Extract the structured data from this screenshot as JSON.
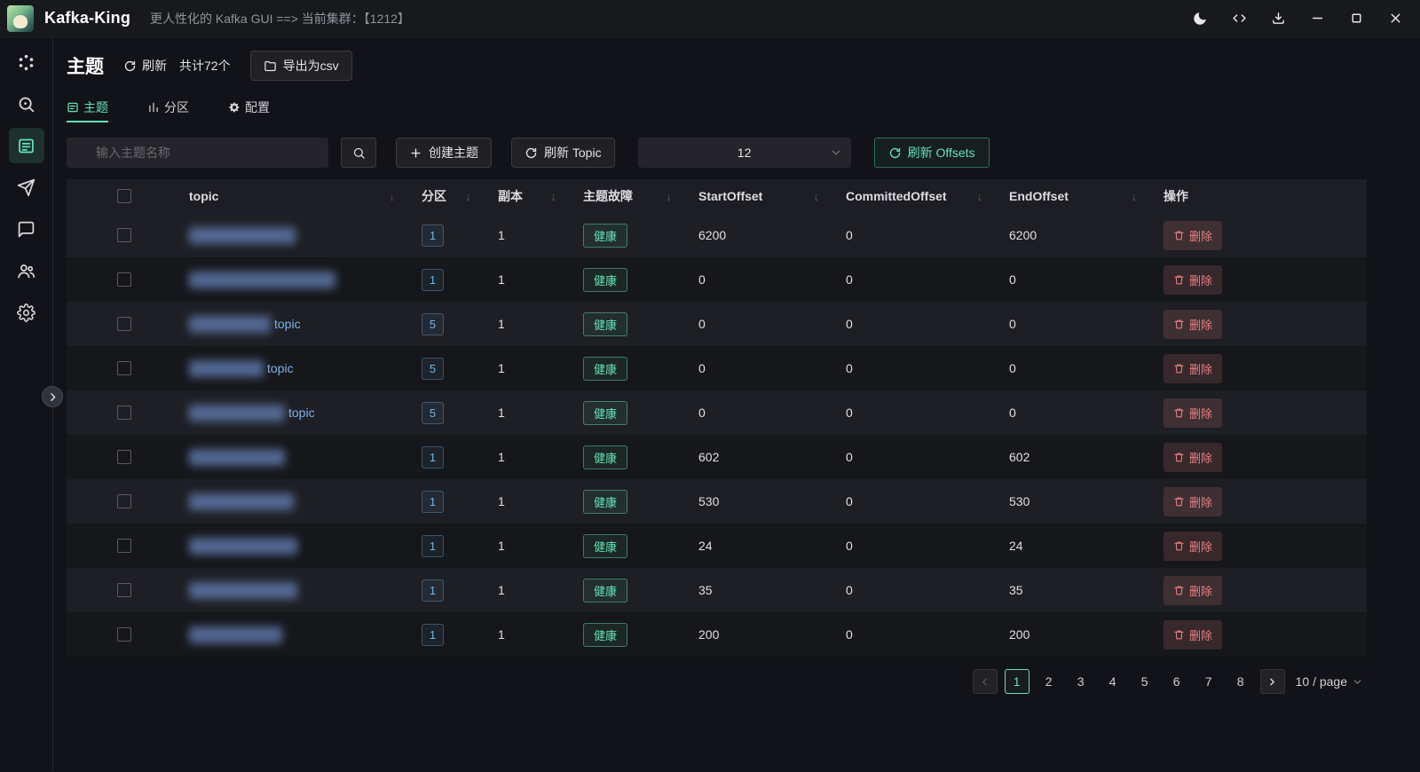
{
  "window": {
    "app_name": "Kafka-King",
    "subtitle": "更人性化的 Kafka GUI ==> 当前集群：【1212】"
  },
  "sidebar": {
    "items": [
      {
        "icon": "cluster-icon",
        "active": false
      },
      {
        "icon": "monitor-icon",
        "active": false
      },
      {
        "icon": "topics-icon",
        "active": true
      },
      {
        "icon": "producer-send-icon",
        "active": false
      },
      {
        "icon": "message-icon",
        "active": false
      },
      {
        "icon": "consumer-group-icon",
        "active": false
      },
      {
        "icon": "settings-icon",
        "active": false
      }
    ]
  },
  "header": {
    "title": "主题",
    "refresh_label": "刷新",
    "total_label": "共计72个",
    "export_csv_label": "导出为csv"
  },
  "tabs": [
    {
      "label": "主题",
      "active": true
    },
    {
      "label": "分区",
      "active": false
    },
    {
      "label": "配置",
      "active": false
    }
  ],
  "toolbar": {
    "search_placeholder": "输入主题名称",
    "create_topic_label": "创建主题",
    "refresh_topic_label": "刷新 Topic",
    "page_size_value": "12",
    "refresh_offsets_label": "刷新 Offsets"
  },
  "table": {
    "columns": [
      {
        "label": "",
        "sortable": false
      },
      {
        "label": "topic",
        "sortable": true
      },
      {
        "label": "分区",
        "sortable": true
      },
      {
        "label": "副本",
        "sortable": true
      },
      {
        "label": "主题故障",
        "sortable": true
      },
      {
        "label": "StartOffset",
        "sortable": true
      },
      {
        "label": "CommittedOffset",
        "sortable": true
      },
      {
        "label": "EndOffset",
        "sortable": true
      },
      {
        "label": "操作",
        "sortable": false
      }
    ],
    "health_label": "健康",
    "delete_label": "删除",
    "sort_glyph": "↓",
    "rows": [
      {
        "topic_visible": "",
        "redact_width": 120,
        "partition": "1",
        "replica": "1",
        "health": "健康",
        "start_offset": "6200",
        "committed_offset": "0",
        "end_offset": "6200"
      },
      {
        "topic_visible": "",
        "redact_width": 165,
        "partition": "1",
        "replica": "1",
        "health": "健康",
        "start_offset": "0",
        "committed_offset": "0",
        "end_offset": "0"
      },
      {
        "topic_visible": "topic",
        "redact_width": 92,
        "partition": "5",
        "replica": "1",
        "health": "健康",
        "start_offset": "0",
        "committed_offset": "0",
        "end_offset": "0"
      },
      {
        "topic_visible": "topic",
        "redact_width": 84,
        "partition": "5",
        "replica": "1",
        "health": "健康",
        "start_offset": "0",
        "committed_offset": "0",
        "end_offset": "0"
      },
      {
        "topic_visible": "topic",
        "redact_width": 108,
        "partition": "5",
        "replica": "1",
        "health": "健康",
        "start_offset": "0",
        "committed_offset": "0",
        "end_offset": "0"
      },
      {
        "topic_visible": "",
        "redact_width": 108,
        "partition": "1",
        "replica": "1",
        "health": "健康",
        "start_offset": "602",
        "committed_offset": "0",
        "end_offset": "602"
      },
      {
        "topic_visible": "",
        "redact_width": 118,
        "partition": "1",
        "replica": "1",
        "health": "健康",
        "start_offset": "530",
        "committed_offset": "0",
        "end_offset": "530"
      },
      {
        "topic_visible": "",
        "redact_width": 122,
        "partition": "1",
        "replica": "1",
        "health": "健康",
        "start_offset": "24",
        "committed_offset": "0",
        "end_offset": "24"
      },
      {
        "topic_visible": "",
        "redact_width": 122,
        "partition": "1",
        "replica": "1",
        "health": "健康",
        "start_offset": "35",
        "committed_offset": "0",
        "end_offset": "35"
      },
      {
        "topic_visible": "",
        "redact_width": 105,
        "partition": "1",
        "replica": "1",
        "health": "健康",
        "start_offset": "200",
        "committed_offset": "0",
        "end_offset": "200"
      }
    ]
  },
  "pagination": {
    "pages": [
      "1",
      "2",
      "3",
      "4",
      "5",
      "6",
      "7",
      "8"
    ],
    "active_page": "1",
    "page_size_label": "10 / page"
  },
  "colors": {
    "accent_green": "#63e2b7",
    "error_red": "#e88080",
    "info_blue": "#6fb5e8"
  }
}
